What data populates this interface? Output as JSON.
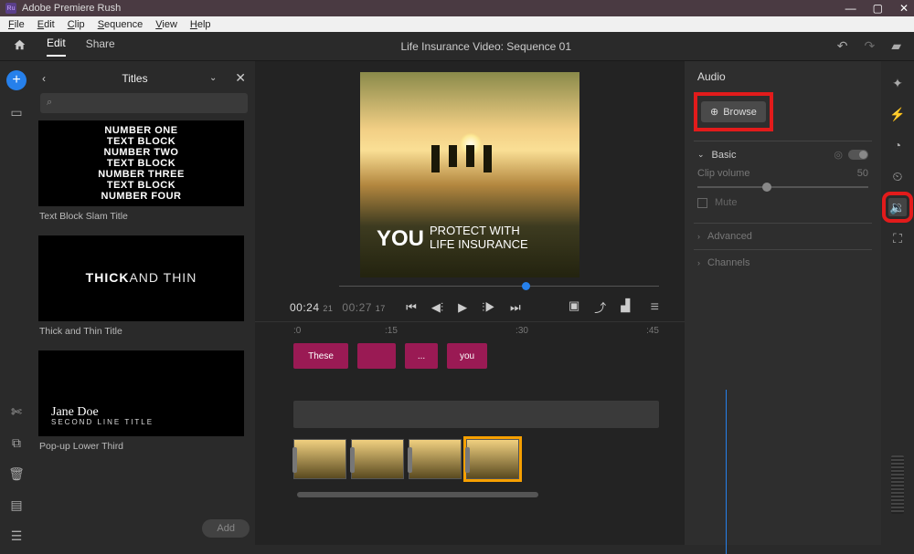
{
  "app": {
    "name": "Adobe Premiere Rush"
  },
  "menubar": [
    "File",
    "Edit",
    "Clip",
    "Sequence",
    "View",
    "Help"
  ],
  "topnav": {
    "tabs": {
      "edit": "Edit",
      "share": "Share"
    },
    "document": "Life Insurance Video: Sequence 01"
  },
  "panel_titles": {
    "header": "Titles",
    "search_placeholder": "",
    "items": [
      {
        "name": "Text Block Slam Title",
        "sample_lines": [
          "NUMBER ONE",
          "TEXT BLOCK",
          "NUMBER TWO",
          "TEXT BLOCK",
          "NUMBER THREE",
          "TEXT BLOCK",
          "NUMBER FOUR"
        ]
      },
      {
        "name": "Thick and Thin Title",
        "sample_thick": "THICK",
        "sample_thin": " AND THIN"
      },
      {
        "name": "Pop-up Lower Third",
        "sample_name": "Jane Doe",
        "sample_sub": "SECOND LINE TITLE"
      }
    ],
    "add_button": "Add"
  },
  "preview": {
    "you": "YOU",
    "tagline1": "PROTECT WITH",
    "tagline2": "LIFE INSURANCE"
  },
  "transport": {
    "current": "00:24",
    "current_fr": "21",
    "total": "00:27",
    "total_fr": "17"
  },
  "ruler": {
    "t0": ":0",
    "t1": ":15",
    "t2": ":30",
    "t3": ":45"
  },
  "title_clips": [
    "These",
    "",
    "...",
    "you"
  ],
  "panel_audio": {
    "header": "Audio",
    "browse": "Browse",
    "basic": "Basic",
    "clip_volume_label": "Clip volume",
    "clip_volume_value": "50",
    "mute": "Mute",
    "advanced": "Advanced",
    "channels": "Channels"
  }
}
